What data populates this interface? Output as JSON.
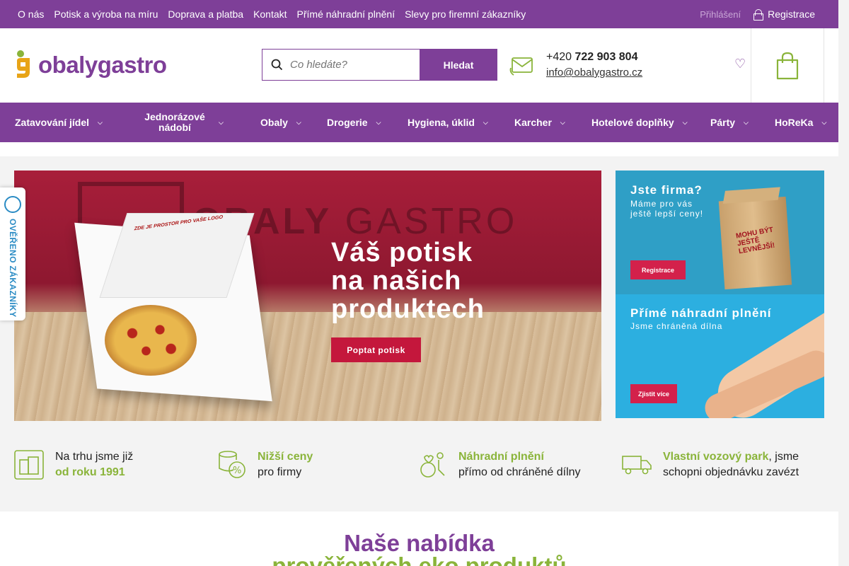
{
  "topbar": {
    "links": [
      "O nás",
      "Potisk a výroba na míru",
      "Doprava a platba",
      "Kontakt",
      "Přímé náhradní plnění",
      "Slevy pro firemní zákazníky"
    ],
    "login_label": "Přihlášení",
    "register_label": "Registrace"
  },
  "header": {
    "logo_text_a": "obaly",
    "logo_text_b": "gastro",
    "search_placeholder": "Co hledáte?",
    "search_button": "Hledat",
    "phone_prefix": "+420",
    "phone_number": "722 903 804",
    "email": "info@obalygastro.cz"
  },
  "nav": {
    "items": [
      {
        "label": "Zatavování jídel"
      },
      {
        "label": "Jednorázové nádobí"
      },
      {
        "label": "Obaly"
      },
      {
        "label": "Drogerie"
      },
      {
        "label": "Hygiena, úklid"
      },
      {
        "label": "Karcher"
      },
      {
        "label": "Hotelové doplňky"
      },
      {
        "label": "Párty"
      },
      {
        "label": "HoReKa"
      }
    ]
  },
  "hero": {
    "ghost_text_bold": "OBALY",
    "ghost_text_light": " GASTRO",
    "headline_1": "Váš potisk",
    "headline_2": "na našich",
    "headline_3": "produktech",
    "cta": "Poptat potisk",
    "box_text": "ZDE JE PROSTOR PRO VAŠE LOGO"
  },
  "side_banners": [
    {
      "title": "Jste firma?",
      "sub_1": "Máme pro vás",
      "sub_2": "ještě lepší ceny!",
      "button": "Registrace",
      "bag_text": "MOHU BÝT JEŠTĚ LEVNĚJŠÍ!"
    },
    {
      "title": "Přímé náhradní plnění",
      "sub_1": "Jsme chráněná dílna",
      "button": "Zjistit více"
    }
  ],
  "badge": {
    "text": "OVĚŘENO ZÁKAZNÍKY"
  },
  "usps": [
    {
      "line1": "Na trhu jsme již",
      "line2": "od roku 1991"
    },
    {
      "line1": "Nižší ceny",
      "line2": "pro firmy"
    },
    {
      "line1": "Náhradní plnění",
      "line2": "přímo od chráněné dílny"
    },
    {
      "line1_strong": "Vlastní vozový park",
      "line1_rest": ", jsme",
      "line2": "schopni objednávku zavézt"
    }
  ],
  "offer": {
    "title": "Naše nabídka",
    "subtitle": "prověřených eko produktů"
  },
  "colors": {
    "brand_purple": "#7e3f98",
    "brand_green": "#8ab43a",
    "cta_red": "#c4173c"
  }
}
